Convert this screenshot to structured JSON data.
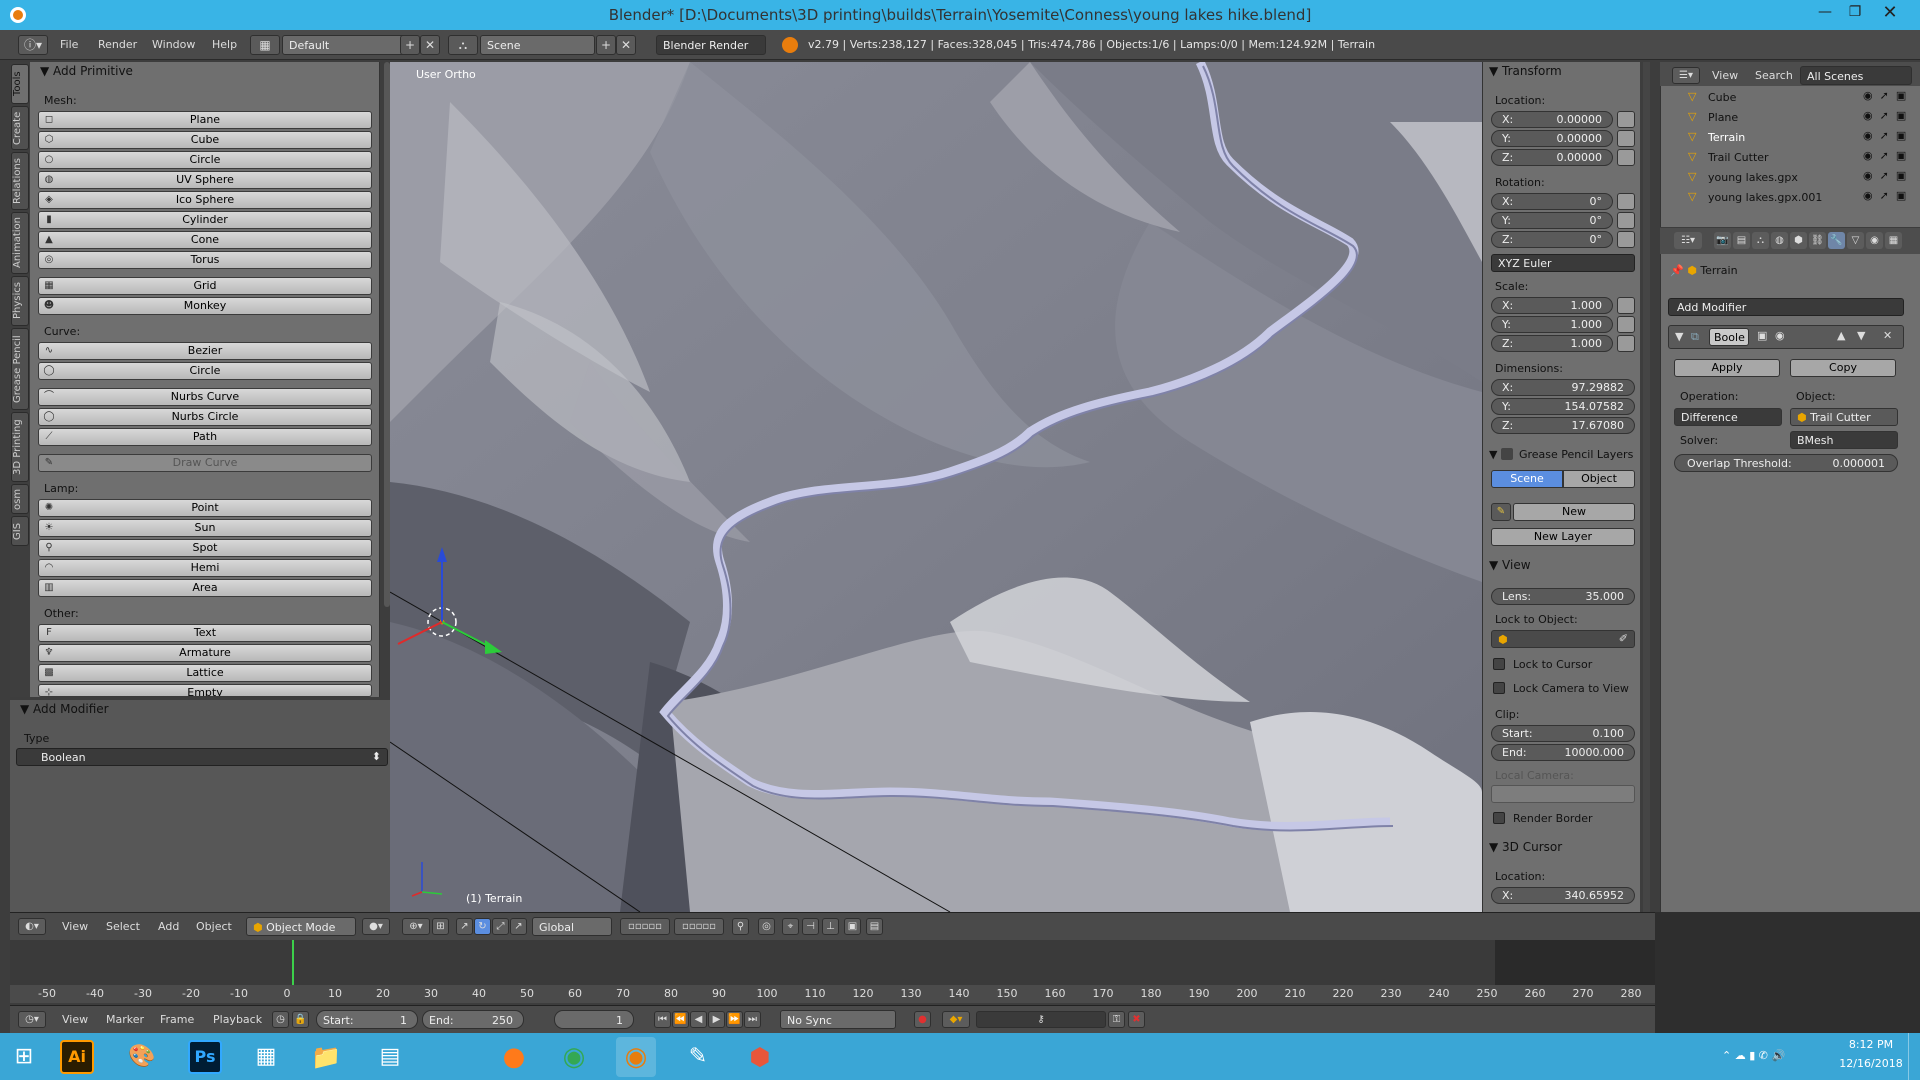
{
  "window": {
    "title": "Blender* [D:\\Documents\\3D printing\\builds\\Terrain\\Yosemite\\Conness\\young lakes hike.blend]"
  },
  "info_menu": [
    "File",
    "Render",
    "Window",
    "Help"
  ],
  "screen_layout": "Default",
  "scene": "Scene",
  "render_engine": "Blender Render",
  "stats": "v2.79 | Verts:238,127 | Faces:328,045 | Tris:474,786 | Objects:1/6 | Lamps:0/0 | Mem:124.92M | Terrain",
  "tool_tabs": [
    "Tools",
    "Create",
    "Relations",
    "Animation",
    "Physics",
    "Grease Pencil",
    "3D Printing",
    "osm",
    "GIS"
  ],
  "tool_panel": {
    "title": "Add Primitive",
    "mesh_label": "Mesh:",
    "mesh": [
      "Plane",
      "Cube",
      "Circle",
      "UV Sphere",
      "Ico Sphere",
      "Cylinder",
      "Cone",
      "Torus"
    ],
    "mesh2": [
      "Grid",
      "Monkey"
    ],
    "curve_label": "Curve:",
    "curve": [
      "Bezier",
      "Circle"
    ],
    "curve2": [
      "Nurbs Curve",
      "Nurbs Circle",
      "Path"
    ],
    "draw_curve": "Draw Curve",
    "lamp_label": "Lamp:",
    "lamp": [
      "Point",
      "Sun",
      "Spot",
      "Hemi",
      "Area"
    ],
    "other_label": "Other:",
    "other": [
      "Text",
      "Armature",
      "Lattice",
      "Empty"
    ]
  },
  "add_modifier_op": {
    "title": "Add Modifier",
    "type_label": "Type",
    "type_value": "Boolean"
  },
  "viewport": {
    "label": "User Ortho",
    "object_label": "(1) Terrain"
  },
  "npanel": {
    "transform": "Transform",
    "location": "Location:",
    "loc": [
      {
        "a": "X:",
        "v": "0.00000"
      },
      {
        "a": "Y:",
        "v": "0.00000"
      },
      {
        "a": "Z:",
        "v": "0.00000"
      }
    ],
    "rotation": "Rotation:",
    "rot": [
      {
        "a": "X:",
        "v": "0°"
      },
      {
        "a": "Y:",
        "v": "0°"
      },
      {
        "a": "Z:",
        "v": "0°"
      }
    ],
    "rot_mode": "XYZ Euler",
    "scale": "Scale:",
    "scl": [
      {
        "a": "X:",
        "v": "1.000"
      },
      {
        "a": "Y:",
        "v": "1.000"
      },
      {
        "a": "Z:",
        "v": "1.000"
      }
    ],
    "dimensions": "Dimensions:",
    "dim": [
      {
        "a": "X:",
        "v": "97.29882"
      },
      {
        "a": "Y:",
        "v": "154.07582"
      },
      {
        "a": "Z:",
        "v": "17.67080"
      }
    ],
    "grease": "Grease Pencil Layers",
    "gp_scene": "Scene",
    "gp_object": "Object",
    "gp_new": "New",
    "gp_new_layer": "New Layer",
    "view": "View",
    "lens_label": "Lens:",
    "lens": "35.000",
    "lock_obj": "Lock to Object:",
    "lock_cursor": "Lock to Cursor",
    "lock_camera": "Lock Camera to View",
    "clip": "Clip:",
    "clip_start_l": "Start:",
    "clip_start": "0.100",
    "clip_end_l": "End:",
    "clip_end": "10000.000",
    "local_camera": "Local Camera:",
    "render_border": "Render Border",
    "cursor": "3D Cursor",
    "cursor_loc": "Location:",
    "cursor_x_l": "X:",
    "cursor_x": "340.65952"
  },
  "outliner": {
    "menu": [
      "View",
      "Search"
    ],
    "filter": "All Scenes",
    "items": [
      "Cube",
      "Plane",
      "Terrain",
      "Trail Cutter",
      "young lakes.gpx",
      "young lakes.gpx.001"
    ]
  },
  "properties": {
    "object": "Terrain",
    "add_modifier": "Add Modifier",
    "mod_name": "Boole",
    "apply": "Apply",
    "copy": "Copy",
    "operation_l": "Operation:",
    "operation": "Difference",
    "object_l": "Object:",
    "object_v": "Trail Cutter",
    "solver_l": "Solver:",
    "solver": "BMesh",
    "overlap_l": "Overlap Threshold:",
    "overlap": "0.000001"
  },
  "view3d_header": {
    "menu": [
      "View",
      "Select",
      "Add",
      "Object"
    ],
    "mode": "Object Mode",
    "orientation": "Global"
  },
  "timeline": {
    "ticks": [
      "-50",
      "-40",
      "-30",
      "-20",
      "-10",
      "0",
      "10",
      "20",
      "30",
      "40",
      "50",
      "60",
      "70",
      "80",
      "90",
      "100",
      "110",
      "120",
      "130",
      "140",
      "150",
      "160",
      "170",
      "180",
      "190",
      "200",
      "210",
      "220",
      "230",
      "240",
      "250",
      "260",
      "270",
      "280"
    ],
    "menu": [
      "View",
      "Marker",
      "Frame",
      "Playback"
    ],
    "start_l": "Start:",
    "start": "1",
    "end_l": "End:",
    "end": "250",
    "current": "1",
    "sync": "No Sync"
  },
  "taskbar": {
    "time": "8:12 PM",
    "date": "12/16/2018"
  },
  "colors": {
    "taskbar": "#3aa6d6",
    "titlebar": "#39b4e6",
    "active_tab": "#5b8ee0",
    "orange": "#e87d0d"
  }
}
